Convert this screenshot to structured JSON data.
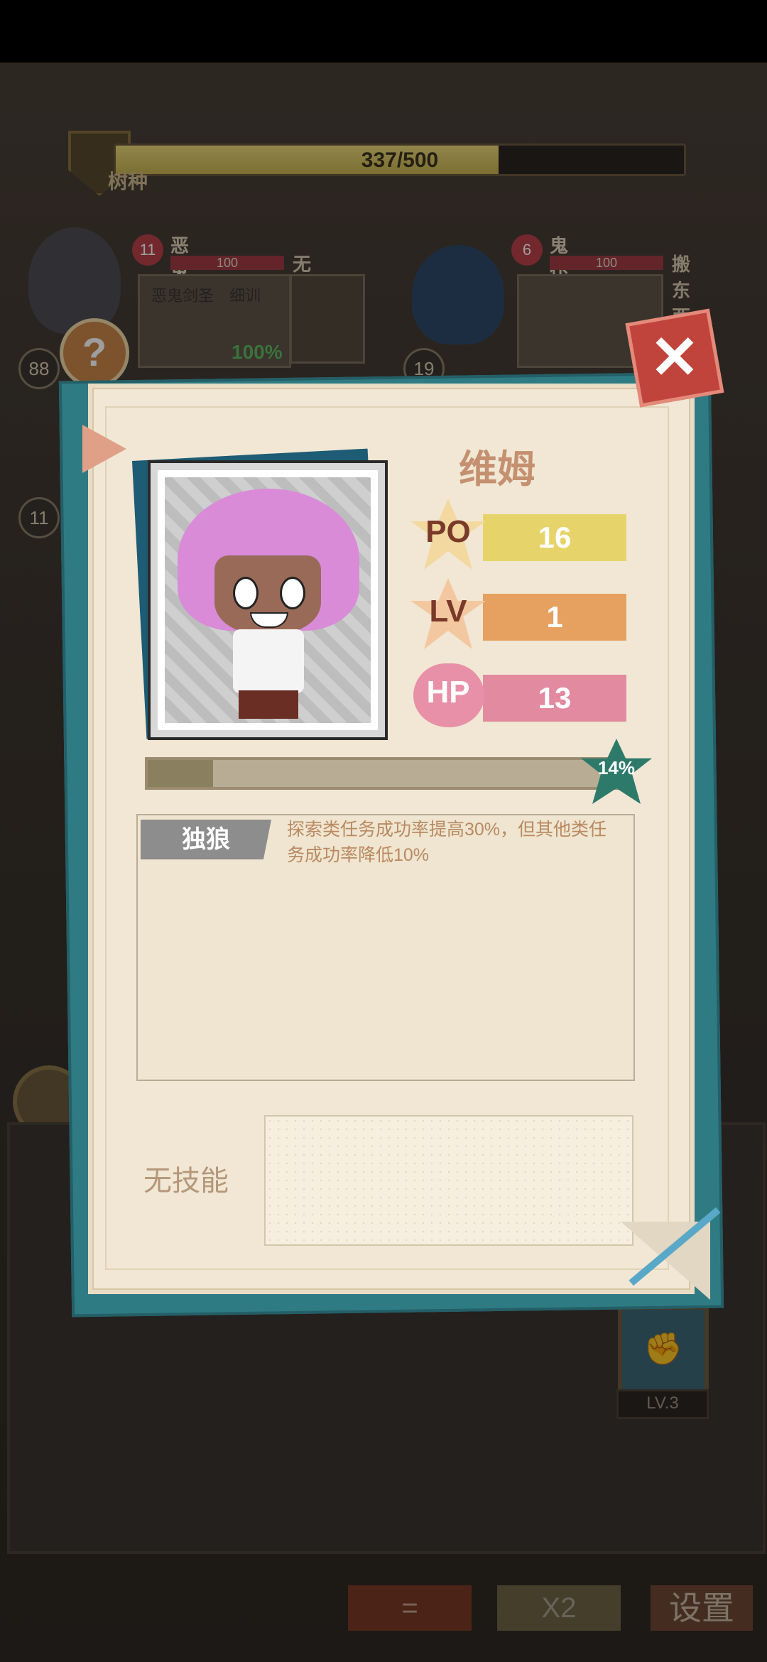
{
  "resource": {
    "label": "树种",
    "current": 337,
    "max": 500,
    "text": "337/500",
    "fill_fraction": 0.674
  },
  "tasks": [
    {
      "name": "恶鬼",
      "hearts": "11",
      "hp": "100",
      "site": "无人哨站",
      "members": "恶鬼剑圣　细训",
      "percent": "100%",
      "level": "88"
    },
    {
      "name": "鬼仆",
      "hearts": "6",
      "hp": "100",
      "site": "搬东西",
      "level": "19"
    }
  ],
  "side_levels": [
    "11"
  ],
  "help_icon": "?",
  "close_icon": "✕",
  "character": {
    "name": "维姆",
    "stats": [
      {
        "label": "PO",
        "value": "16",
        "color": "#e6d46a",
        "icon": "star-icon"
      },
      {
        "label": "LV",
        "value": "1",
        "color": "#e6a060",
        "icon": "star-icon"
      },
      {
        "label": "HP",
        "value": "13",
        "color": "#e28aa0",
        "icon": "heart-icon"
      }
    ],
    "xp_percent": "14%",
    "xp_fraction": 0.14
  },
  "trait": {
    "name": "独狼",
    "desc": "探索类任务成功率提高30%，但其他类任务成功率降低10%"
  },
  "skill": {
    "empty_label": "无技能"
  },
  "skill_icon": {
    "level": "LV.3"
  },
  "bottom_buttons": {
    "eq": "=",
    "x2": "X2",
    "settings": "设置"
  },
  "colors": {
    "teal": "#2f7b84",
    "paper": "#f1e7d4",
    "close": "#c0443c",
    "hair": "#d98bd8"
  }
}
